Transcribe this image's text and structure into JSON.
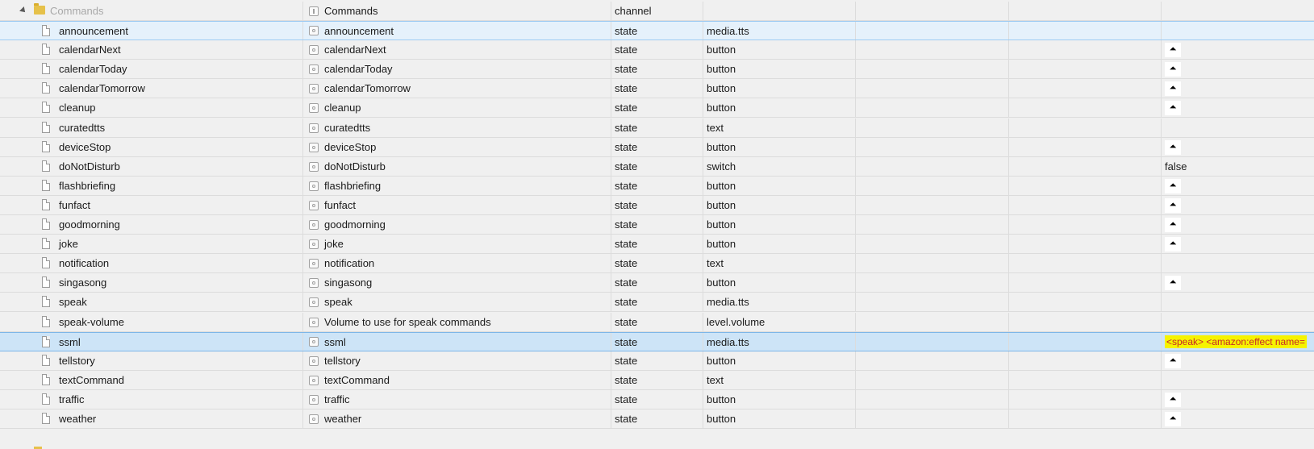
{
  "colors": {
    "background": "#f0f0f0",
    "hover_row": "#e5f1fb",
    "selected_row": "#cde4f7",
    "highlight": "#f6f300",
    "highlight_text": "#c62828",
    "folder": "#e6c14a"
  },
  "header": {
    "name": "Commands",
    "role_name": "Commands",
    "type": "channel"
  },
  "rows": [
    {
      "name": "announcement",
      "title": "announcement",
      "type": "state",
      "role": "media.tts",
      "value": "",
      "button": false,
      "state": "hover"
    },
    {
      "name": "calendarNext",
      "title": "calendarNext",
      "type": "state",
      "role": "button",
      "value": "",
      "button": true
    },
    {
      "name": "calendarToday",
      "title": "calendarToday",
      "type": "state",
      "role": "button",
      "value": "",
      "button": true
    },
    {
      "name": "calendarTomorrow",
      "title": "calendarTomorrow",
      "type": "state",
      "role": "button",
      "value": "",
      "button": true
    },
    {
      "name": "cleanup",
      "title": "cleanup",
      "type": "state",
      "role": "button",
      "value": "",
      "button": true
    },
    {
      "name": "curatedtts",
      "title": "curatedtts",
      "type": "state",
      "role": "text",
      "value": "",
      "button": false
    },
    {
      "name": "deviceStop",
      "title": "deviceStop",
      "type": "state",
      "role": "button",
      "value": "",
      "button": true
    },
    {
      "name": "doNotDisturb",
      "title": "doNotDisturb",
      "type": "state",
      "role": "switch",
      "value": "false",
      "button": false
    },
    {
      "name": "flashbriefing",
      "title": "flashbriefing",
      "type": "state",
      "role": "button",
      "value": "",
      "button": true
    },
    {
      "name": "funfact",
      "title": "funfact",
      "type": "state",
      "role": "button",
      "value": "",
      "button": true
    },
    {
      "name": "goodmorning",
      "title": "goodmorning",
      "type": "state",
      "role": "button",
      "value": "",
      "button": true
    },
    {
      "name": "joke",
      "title": "joke",
      "type": "state",
      "role": "button",
      "value": "",
      "button": true
    },
    {
      "name": "notification",
      "title": "notification",
      "type": "state",
      "role": "text",
      "value": "",
      "button": false
    },
    {
      "name": "singasong",
      "title": "singasong",
      "type": "state",
      "role": "button",
      "value": "",
      "button": true
    },
    {
      "name": "speak",
      "title": "speak",
      "type": "state",
      "role": "media.tts",
      "value": "",
      "button": false
    },
    {
      "name": "speak-volume",
      "title": "Volume to use for speak commands",
      "type": "state",
      "role": "level.volume",
      "value": "",
      "button": false
    },
    {
      "name": "ssml",
      "title": "ssml",
      "type": "state",
      "role": "media.tts",
      "value": "<speak> <amazon:effect name=",
      "button": false,
      "state": "selected",
      "highlight": true
    },
    {
      "name": "tellstory",
      "title": "tellstory",
      "type": "state",
      "role": "button",
      "value": "",
      "button": true
    },
    {
      "name": "textCommand",
      "title": "textCommand",
      "type": "state",
      "role": "text",
      "value": "",
      "button": false
    },
    {
      "name": "traffic",
      "title": "traffic",
      "type": "state",
      "role": "button",
      "value": "",
      "button": true
    },
    {
      "name": "weather",
      "title": "weather",
      "type": "state",
      "role": "button",
      "value": "",
      "button": true
    }
  ],
  "icons": {
    "button": "bell-icon",
    "expander": "expand-arrow-icon",
    "folder": "folder-icon",
    "state": "document-icon"
  },
  "glyphs": {
    "button": "⏶"
  }
}
